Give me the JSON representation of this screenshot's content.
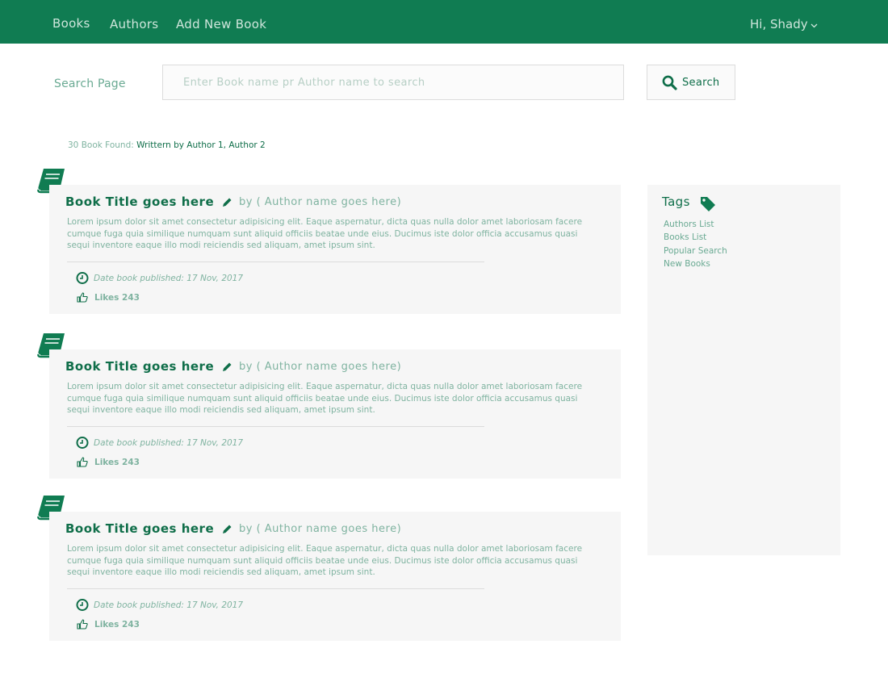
{
  "nav": {
    "links": [
      "Books",
      "Authors",
      "Add New Book"
    ],
    "user_greeting": "Hi, Shady"
  },
  "search": {
    "label": "Search Page",
    "placeholder": "Enter Book name pr Author name to search",
    "button_label": "Search"
  },
  "results": {
    "count_text": "30 Book Found:",
    "authors_text": "Writtern by Author 1, Author 2"
  },
  "books": [
    {
      "title": "Book Title goes here",
      "author": "by ( Author name goes here)",
      "description": "Lorem ipsum dolor sit amet consectetur adipisicing elit. Eaque aspernatur, dicta quas nulla dolor amet laboriosam facere cumque fuga quia similique numquam sunt aliquid officiis beatae unde eius. Ducimus iste dolor officia accusamus quasi sequi inventore eaque illo modi reiciendis sed aliquam, amet ipsum sint.",
      "date": "Date book published: 17 Nov, 2017",
      "likes": "Likes 243"
    },
    {
      "title": "Book Title goes here",
      "author": "by ( Author name goes here)",
      "description": "Lorem ipsum dolor sit amet consectetur adipisicing elit. Eaque aspernatur, dicta quas nulla dolor amet laboriosam facere cumque fuga quia similique numquam sunt aliquid officiis beatae unde eius. Ducimus iste dolor officia accusamus quasi sequi inventore eaque illo modi reiciendis sed aliquam, amet ipsum sint.",
      "date": "Date book published: 17 Nov, 2017",
      "likes": "Likes 243"
    },
    {
      "title": "Book Title goes here",
      "author": "by ( Author name goes here)",
      "description": "Lorem ipsum dolor sit amet consectetur adipisicing elit. Eaque aspernatur, dicta quas nulla dolor amet laboriosam facere cumque fuga quia similique numquam sunt aliquid officiis beatae unde eius. Ducimus iste dolor officia accusamus quasi sequi inventore eaque illo modi reiciendis sed aliquam, amet ipsum sint.",
      "date": "Date book published: 17 Nov, 2017",
      "likes": "Likes 243"
    }
  ],
  "sidebar": {
    "title": "Tags",
    "tags": [
      "Authors List",
      "Books List",
      "Popular Search",
      "New Books"
    ]
  },
  "colors": {
    "brand": "#107c52",
    "title_text": "#0f6e49",
    "muted_text": "#7fb3a0",
    "card_bg": "#f6f6f6"
  },
  "icons": {
    "book": "book-icon",
    "pencil": "pencil-icon",
    "clock": "clock-icon",
    "thumbs_up": "thumbs-up-icon",
    "tag": "tag-icon",
    "search": "search-icon",
    "chevron": "chevron-down-icon"
  }
}
